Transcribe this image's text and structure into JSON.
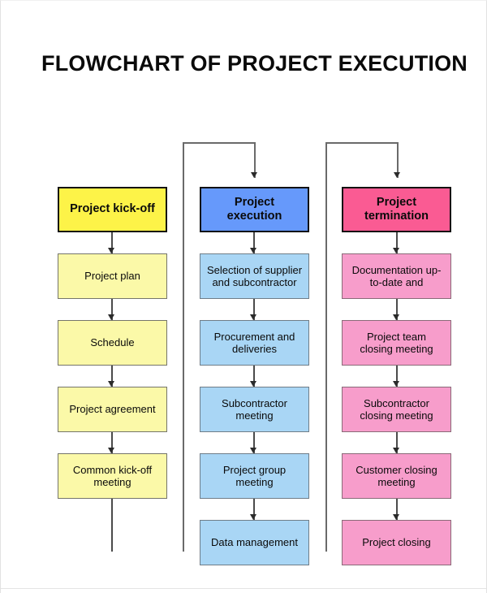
{
  "title": "FLOWCHART OF PROJECT EXECUTION",
  "colors": {
    "kickoff_header": "#fdf348",
    "kickoff_step": "#fbf9a8",
    "execution_header": "#6699fb",
    "execution_step": "#a9d6f5",
    "termination_header": "#fa5b93",
    "termination_step": "#f79dcb",
    "connector": "#4b4b4b",
    "text": "#0a0a0a"
  },
  "chart_data": {
    "type": "flowchart",
    "title": "FLOWCHART OF PROJECT EXECUTION",
    "orientation": "vertical-columns",
    "columns": [
      {
        "id": "kickoff",
        "header": "Project kick-off",
        "steps": [
          "Project plan",
          "Schedule",
          "Project agreement",
          "Common kick-off meeting"
        ]
      },
      {
        "id": "execution",
        "header": "Project execution",
        "steps": [
          "Selection of supplier and subcontractor",
          "Procurement and deliveries",
          "Subcontractor meeting",
          "Project group meeting",
          "Data management"
        ]
      },
      {
        "id": "termination",
        "header": "Project termination",
        "steps": [
          "Documentation up-to-date and",
          "Project team closing meeting",
          "Subcontractor closing meeting",
          "Customer closing meeting",
          "Project closing"
        ]
      }
    ]
  },
  "columns": {
    "kickoff": {
      "header": "Project kick-off",
      "step1": "Project plan",
      "step2": "Schedule",
      "step3": "Project agreement",
      "step4_line1": "Common kick-off",
      "step4_line2": "meeting"
    },
    "execution": {
      "header_line1": "Project",
      "header_line2": "execution",
      "step1_line1": "Selection of supplier",
      "step1_line2": "and subcontractor",
      "step2_line1": "Procurement and",
      "step2_line2": "deliveries",
      "step3_line1": "Subcontractor",
      "step3_line2": "meeting",
      "step4_line1": "Project group",
      "step4_line2": "meeting",
      "step5": "Data management"
    },
    "termination": {
      "header_line1": "Project",
      "header_line2": "termination",
      "step1_line1": "Documentation up-",
      "step1_line2": "to-date and",
      "step2_line1": "Project team",
      "step2_line2": "closing meeting",
      "step3_line1": "Subcontractor",
      "step3_line2": "closing meeting",
      "step4_line1": "Customer closing",
      "step4_line2": "meeting",
      "step5": "Project closing"
    }
  }
}
